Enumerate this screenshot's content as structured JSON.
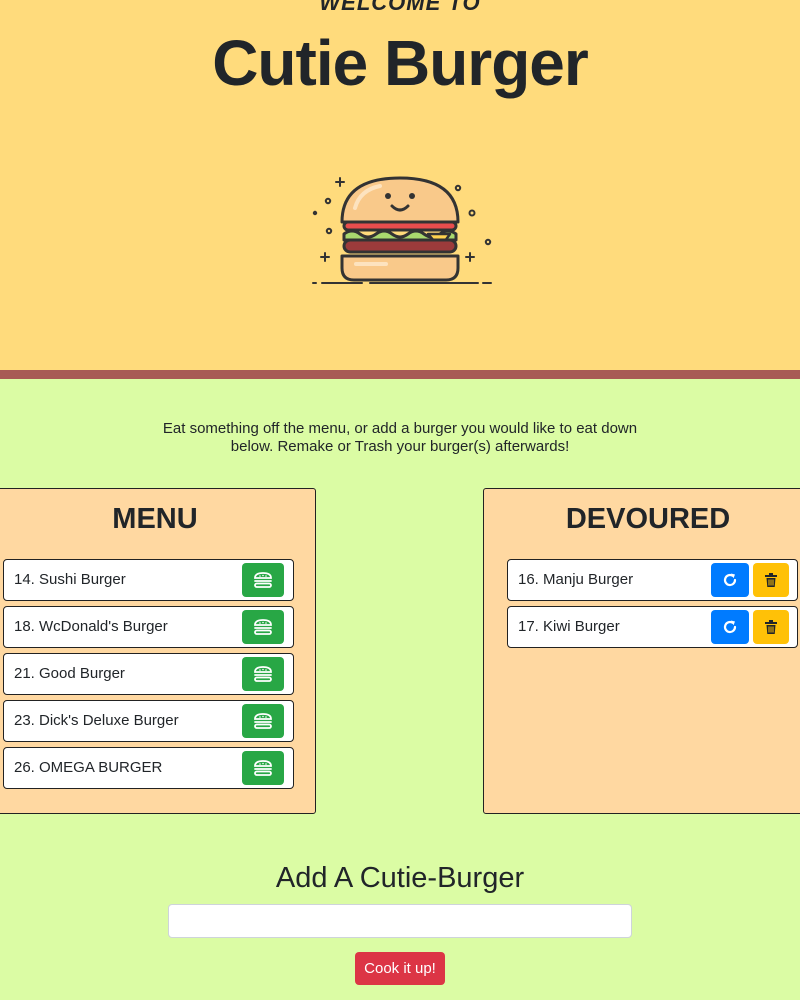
{
  "header": {
    "welcome": "WELCOME TO",
    "title": "Cutie Burger",
    "image_icon": "smiling-burger-illustration"
  },
  "intro_text": "Eat something off the menu, or add a burger you would like to eat down below. Remake or Trash your burger(s) afterwards!",
  "menu": {
    "title": "MENU",
    "items": [
      {
        "label": "14. Sushi Burger"
      },
      {
        "label": "18. WcDonald's Burger"
      },
      {
        "label": "21. Good Burger"
      },
      {
        "label": "23. Dick's Deluxe Burger"
      },
      {
        "label": "26. OMEGA BURGER"
      }
    ],
    "eat_icon": "burger-icon"
  },
  "devoured": {
    "title": "DEVOURED",
    "items": [
      {
        "label": "16. Manju Burger"
      },
      {
        "label": "17. Kiwi Burger"
      }
    ],
    "remake_icon": "redo-icon",
    "trash_icon": "trash-icon"
  },
  "add_form": {
    "title": "Add A Cutie-Burger",
    "input_value": "",
    "input_placeholder": "",
    "submit_label": "Cook it up!"
  },
  "colors": {
    "hero_bg": "#ffdb7c",
    "hero_border": "#a85a55",
    "page_bg": "#dbfca4",
    "panel_bg": "#ffd8a1",
    "eat_button": "#28a745",
    "remake_button": "#007bff",
    "trash_button": "#ffc107",
    "submit_button": "#dc3545"
  }
}
